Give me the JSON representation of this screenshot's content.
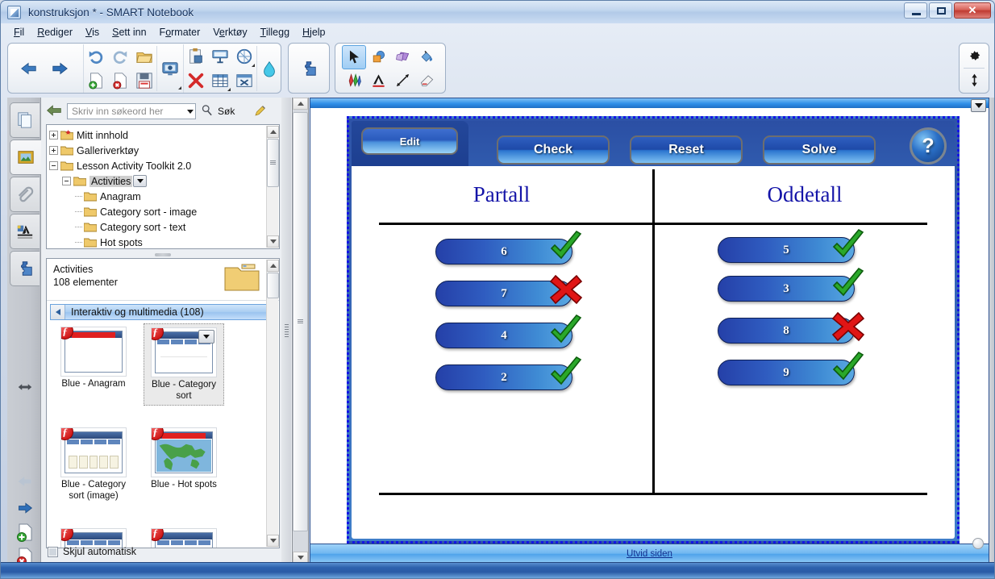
{
  "window": {
    "title": "konstruksjon * - SMART Notebook",
    "icon": "notebook-icon",
    "controls": {
      "minimize": "minimize-icon",
      "maximize": "maximize-icon",
      "close": "close-icon"
    }
  },
  "menubar": {
    "items": [
      {
        "label": "Fil",
        "accel": "F"
      },
      {
        "label": "Rediger",
        "accel": "R"
      },
      {
        "label": "Vis",
        "accel": "V"
      },
      {
        "label": "Sett inn",
        "accel": "S"
      },
      {
        "label": "Formater",
        "accel": "o"
      },
      {
        "label": "Verktøy",
        "accel": "e"
      },
      {
        "label": "Tillegg",
        "accel": "T"
      },
      {
        "label": "Hjelp",
        "accel": "H"
      }
    ]
  },
  "toolbar": {
    "nav": [
      {
        "name": "previous-page-button",
        "icon": "arrow-left-icon"
      },
      {
        "name": "next-page-button",
        "icon": "arrow-right-icon"
      }
    ],
    "edit": [
      {
        "name": "undo-button",
        "icon": "undo-icon"
      },
      {
        "name": "redo-button",
        "icon": "redo-icon"
      },
      {
        "name": "open-file-button",
        "icon": "folder-open-icon"
      },
      {
        "name": "add-page-button",
        "icon": "page-add-icon"
      },
      {
        "name": "delete-page-button",
        "icon": "page-delete-icon"
      },
      {
        "name": "save-button",
        "icon": "floppy-save-icon"
      }
    ],
    "screen": {
      "name": "screen-shade-button",
      "icon": "monitor-icon"
    },
    "insert": [
      {
        "name": "paste-clipboard-button",
        "icon": "clipboard-icon"
      },
      {
        "name": "screen-capture-button",
        "icon": "screen-capture-icon"
      },
      {
        "name": "measurement-tools-button",
        "icon": "compass-icon"
      },
      {
        "name": "clear-page-button",
        "icon": "red-x-icon"
      },
      {
        "name": "table-button",
        "icon": "table-icon"
      },
      {
        "name": "full-screen-button",
        "icon": "full-screen-icon"
      }
    ],
    "fill": {
      "name": "fill-color-button",
      "icon": "paint-bucket-icon"
    },
    "addons": {
      "name": "add-ons-button",
      "icon": "puzzle-piece-icon"
    },
    "tools": [
      {
        "name": "select-tool",
        "icon": "cursor-arrow-icon",
        "selected": true
      },
      {
        "name": "shapes-tool",
        "icon": "shapes-icon",
        "selected": false
      },
      {
        "name": "polygon-tool",
        "icon": "polygon-icon",
        "selected": false
      },
      {
        "name": "fill-tool",
        "icon": "paint-can-icon",
        "selected": false
      },
      {
        "name": "pens-tool",
        "icon": "pens-icon",
        "selected": false
      },
      {
        "name": "text-tool",
        "icon": "text-a-icon",
        "selected": false
      },
      {
        "name": "line-tool",
        "icon": "line-icon",
        "selected": false
      },
      {
        "name": "eraser-tool",
        "icon": "eraser-icon",
        "selected": false
      }
    ],
    "right": [
      {
        "name": "toolbar-settings-button",
        "icon": "gear-icon"
      },
      {
        "name": "move-toolbar-button",
        "icon": "updown-arrow-icon"
      }
    ]
  },
  "rail": {
    "tabs": [
      {
        "name": "sidebar-tab-pages",
        "icon": "pages-icon",
        "active": false
      },
      {
        "name": "sidebar-tab-gallery",
        "icon": "gallery-picture-icon",
        "active": true
      },
      {
        "name": "sidebar-tab-attachments",
        "icon": "paperclip-icon",
        "active": false
      },
      {
        "name": "sidebar-tab-properties",
        "icon": "properties-icon",
        "active": false
      },
      {
        "name": "sidebar-tab-addons",
        "icon": "puzzle-piece-icon",
        "active": false
      }
    ],
    "buttons": [
      {
        "name": "resize-panel-button",
        "icon": "left-right-arrow-icon"
      },
      {
        "name": "page-back-button",
        "icon": "arrow-left-icon"
      },
      {
        "name": "page-forward-button",
        "icon": "arrow-right-icon"
      },
      {
        "name": "new-page-button",
        "icon": "page-add-icon"
      },
      {
        "name": "delete-page-button",
        "icon": "page-delete-icon"
      }
    ]
  },
  "panel": {
    "search": {
      "back_icon": "back-arrow-icon",
      "placeholder": "Skriv inn søkeord her",
      "value": "",
      "search_label": "Søk",
      "search_icon": "magnifier-icon",
      "pen_icon": "pen-tool-icon"
    },
    "tree": [
      {
        "label": "Mitt innhold",
        "depth": 0,
        "expander": "plus",
        "folder": "folder-star-icon",
        "selected": false
      },
      {
        "label": "Galleriverktøy",
        "depth": 0,
        "expander": "plus",
        "folder": "folder-icon",
        "selected": false
      },
      {
        "label": "Lesson Activity Toolkit 2.0",
        "depth": 0,
        "expander": "minus",
        "folder": "folder-icon",
        "selected": false
      },
      {
        "label": "Activities",
        "depth": 1,
        "expander": "minus",
        "folder": "folder-icon",
        "selected": true,
        "dropdown": true
      },
      {
        "label": "Anagram",
        "depth": 2,
        "expander": "none",
        "folder": "folder-icon",
        "selected": false
      },
      {
        "label": "Category sort - image",
        "depth": 2,
        "expander": "none",
        "folder": "folder-icon",
        "selected": false
      },
      {
        "label": "Category sort - text",
        "depth": 2,
        "expander": "none",
        "folder": "folder-icon",
        "selected": false
      },
      {
        "label": "Hot spots",
        "depth": 2,
        "expander": "none",
        "folder": "folder-icon",
        "selected": false
      }
    ],
    "gallery": {
      "folder_name": "Activities",
      "item_count": "108 elementer",
      "folder_icon": "folder-large-icon",
      "category": "Interaktiv og multimedia (108)",
      "thumbs": [
        {
          "caption": "Blue - Anagram",
          "badge": "flash-icon",
          "selected": false,
          "style": "redbar"
        },
        {
          "caption": "Blue - Category sort",
          "badge": "flash-icon",
          "selected": true,
          "style": "tabs",
          "dropdown": true
        },
        {
          "caption": "Blue - Category sort (image)",
          "badge": "flash-icon",
          "selected": false,
          "style": "columns"
        },
        {
          "caption": "Blue - Hot spots",
          "badge": "flash-icon",
          "selected": false,
          "style": "map"
        },
        {
          "caption": "",
          "badge": "flash-icon",
          "selected": false,
          "style": "tabs2"
        },
        {
          "caption": "",
          "badge": "flash-icon",
          "selected": false,
          "style": "tabs3"
        }
      ]
    },
    "autohide": {
      "label": "Skjul automatisk",
      "checked": false
    }
  },
  "canvas": {
    "topbar_dropdown": "chevron-down-icon",
    "bottom_link": "Utvid siden",
    "activity": {
      "tab": {
        "label": "Edit",
        "name": "edit-tab"
      },
      "buttons": [
        {
          "label": "Check",
          "name": "check-button"
        },
        {
          "label": "Reset",
          "name": "reset-button"
        },
        {
          "label": "Solve",
          "name": "solve-button"
        }
      ],
      "help": {
        "label": "?",
        "name": "help-button"
      },
      "columns": [
        {
          "heading": "Partall",
          "items": [
            {
              "value": "6",
              "mark": "check"
            },
            {
              "value": "7",
              "mark": "cross"
            },
            {
              "value": "4",
              "mark": "check"
            },
            {
              "value": "2",
              "mark": "check"
            }
          ]
        },
        {
          "heading": "Oddetall",
          "items": [
            {
              "value": "5",
              "mark": "check"
            },
            {
              "value": "3",
              "mark": "check"
            },
            {
              "value": "8",
              "mark": "cross"
            },
            {
              "value": "9",
              "mark": "check"
            }
          ]
        }
      ]
    }
  },
  "colors": {
    "accent_blue": "#2b4f8e",
    "heading_blue": "#1414a8",
    "check_green": "#2aa82a",
    "cross_red": "#e01515",
    "selection_blue": "#1414e6"
  }
}
